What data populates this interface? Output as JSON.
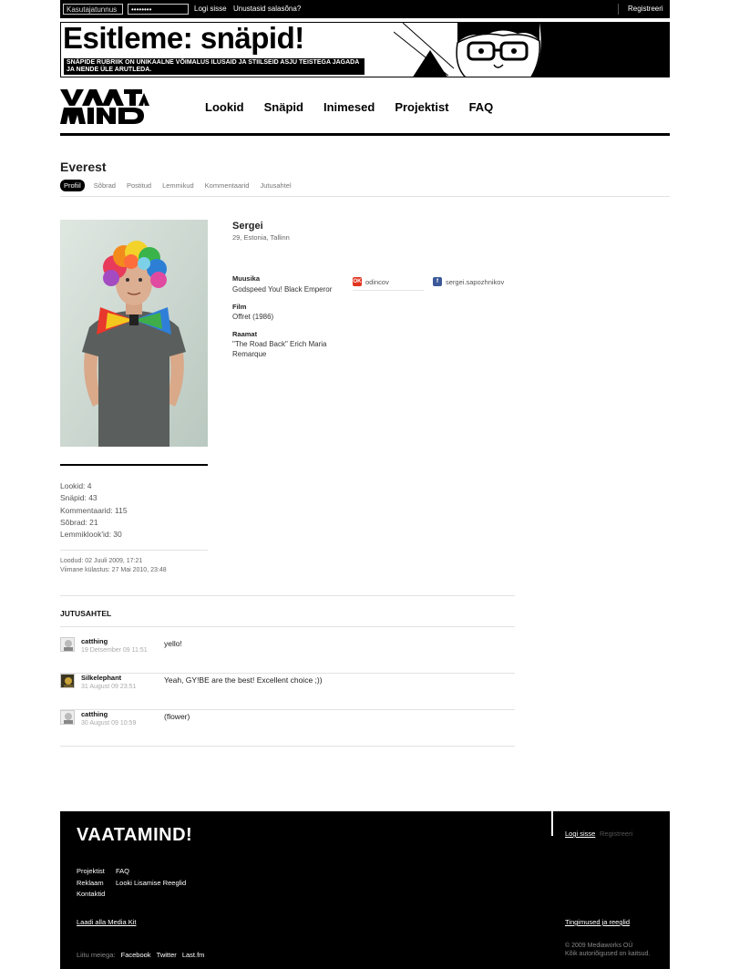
{
  "topbar": {
    "username_placeholder": "Kasutajatunnus",
    "password_value": "••••••••",
    "login_label": "Logi sisse",
    "forgot_label": "Unustasid salasõna?",
    "register_label": "Registreeri"
  },
  "banner": {
    "title": "Esitleme: snäpid!",
    "text": "Snäpide rubriik on unikaalne võimalus ilusaid ja stiilseid asju teistega jagada ja nende üle arutleda."
  },
  "nav": {
    "items": [
      "Lookid",
      "Snäpid",
      "Inimesed",
      "Projektist",
      "FAQ"
    ]
  },
  "profile": {
    "username": "Everest",
    "tabs": [
      "Profiil",
      "Sõbrad",
      "Postitud",
      "Lemmikud",
      "Kommentaarid",
      "Jutusahtel"
    ],
    "active_tab": "Profiil",
    "name": "Sergei",
    "meta": "29, Estonia, Tallinn",
    "fields": [
      {
        "label": "Muusika",
        "value": "Godspeed You! Black Emperor"
      },
      {
        "label": "Film",
        "value": "Offret (1986)"
      },
      {
        "label": "Raamat",
        "value": "\"The Road Back\" Erich Maria Remarque"
      }
    ],
    "social": [
      {
        "icon": "odnoklassniki-icon",
        "text": "odincov",
        "color": "#e2341f"
      },
      {
        "icon": "facebook-icon",
        "text": "sergei.sapozhnikov",
        "color": "#3b5998"
      }
    ],
    "stats": [
      "Lookid: 4",
      "Snäpid: 43",
      "Kommentaarid: 115",
      "Sõbrad: 21",
      "Lemmiklook'id: 30"
    ],
    "created": "Loodud: 02 Juuli 2009, 17:21",
    "last_visit": "Viimane külastus: 27 Mai 2010, 23:48"
  },
  "jutusahtel": {
    "title": "JUTUSAHTEL",
    "comments": [
      {
        "author": "catthing",
        "date": "19 Detsember 09 11:51",
        "text": "yello!"
      },
      {
        "author": "Silkelephant",
        "date": "31 August 09 23:51",
        "text": "Yeah, GY!BE are the best! Excellent choice ;))"
      },
      {
        "author": "catthing",
        "date": "30 August 09 10:59",
        "text": "(flower)"
      }
    ]
  },
  "footer": {
    "logo": "VAATAMIND!",
    "login": "Logi sisse",
    "register": "Registreeri",
    "links_col1": [
      "Projektist",
      "Reklaam",
      "Kontaktid"
    ],
    "links_col2": [
      "FAQ",
      "Looki Lisamise Reeglid"
    ],
    "media_kit": "Laadi alla Media Kit",
    "terms": "Tingimused ja reeglid",
    "follow_label": "Liitu meiega:",
    "follow_links": [
      "Facebook",
      "Twitter",
      "Last.fm"
    ],
    "copyright_1": "© 2009 Mediaworks OÜ",
    "copyright_2": "Kõik autoriõigused on kaitsud."
  },
  "colors": {
    "black": "#000000",
    "divider": "#e2e2e2",
    "odnoklassniki": "#e2341f",
    "facebook": "#3b5998"
  }
}
